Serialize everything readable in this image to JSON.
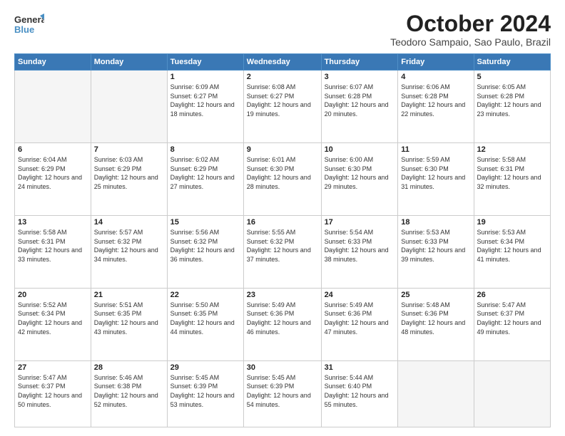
{
  "logo": {
    "line1": "General",
    "line2": "Blue"
  },
  "title": "October 2024",
  "subtitle": "Teodoro Sampaio, Sao Paulo, Brazil",
  "days_header": [
    "Sunday",
    "Monday",
    "Tuesday",
    "Wednesday",
    "Thursday",
    "Friday",
    "Saturday"
  ],
  "weeks": [
    [
      {
        "day": "",
        "detail": ""
      },
      {
        "day": "",
        "detail": ""
      },
      {
        "day": "1",
        "detail": "Sunrise: 6:09 AM\nSunset: 6:27 PM\nDaylight: 12 hours and 18 minutes."
      },
      {
        "day": "2",
        "detail": "Sunrise: 6:08 AM\nSunset: 6:27 PM\nDaylight: 12 hours and 19 minutes."
      },
      {
        "day": "3",
        "detail": "Sunrise: 6:07 AM\nSunset: 6:28 PM\nDaylight: 12 hours and 20 minutes."
      },
      {
        "day": "4",
        "detail": "Sunrise: 6:06 AM\nSunset: 6:28 PM\nDaylight: 12 hours and 22 minutes."
      },
      {
        "day": "5",
        "detail": "Sunrise: 6:05 AM\nSunset: 6:28 PM\nDaylight: 12 hours and 23 minutes."
      }
    ],
    [
      {
        "day": "6",
        "detail": "Sunrise: 6:04 AM\nSunset: 6:29 PM\nDaylight: 12 hours and 24 minutes."
      },
      {
        "day": "7",
        "detail": "Sunrise: 6:03 AM\nSunset: 6:29 PM\nDaylight: 12 hours and 25 minutes."
      },
      {
        "day": "8",
        "detail": "Sunrise: 6:02 AM\nSunset: 6:29 PM\nDaylight: 12 hours and 27 minutes."
      },
      {
        "day": "9",
        "detail": "Sunrise: 6:01 AM\nSunset: 6:30 PM\nDaylight: 12 hours and 28 minutes."
      },
      {
        "day": "10",
        "detail": "Sunrise: 6:00 AM\nSunset: 6:30 PM\nDaylight: 12 hours and 29 minutes."
      },
      {
        "day": "11",
        "detail": "Sunrise: 5:59 AM\nSunset: 6:30 PM\nDaylight: 12 hours and 31 minutes."
      },
      {
        "day": "12",
        "detail": "Sunrise: 5:58 AM\nSunset: 6:31 PM\nDaylight: 12 hours and 32 minutes."
      }
    ],
    [
      {
        "day": "13",
        "detail": "Sunrise: 5:58 AM\nSunset: 6:31 PM\nDaylight: 12 hours and 33 minutes."
      },
      {
        "day": "14",
        "detail": "Sunrise: 5:57 AM\nSunset: 6:32 PM\nDaylight: 12 hours and 34 minutes."
      },
      {
        "day": "15",
        "detail": "Sunrise: 5:56 AM\nSunset: 6:32 PM\nDaylight: 12 hours and 36 minutes."
      },
      {
        "day": "16",
        "detail": "Sunrise: 5:55 AM\nSunset: 6:32 PM\nDaylight: 12 hours and 37 minutes."
      },
      {
        "day": "17",
        "detail": "Sunrise: 5:54 AM\nSunset: 6:33 PM\nDaylight: 12 hours and 38 minutes."
      },
      {
        "day": "18",
        "detail": "Sunrise: 5:53 AM\nSunset: 6:33 PM\nDaylight: 12 hours and 39 minutes."
      },
      {
        "day": "19",
        "detail": "Sunrise: 5:53 AM\nSunset: 6:34 PM\nDaylight: 12 hours and 41 minutes."
      }
    ],
    [
      {
        "day": "20",
        "detail": "Sunrise: 5:52 AM\nSunset: 6:34 PM\nDaylight: 12 hours and 42 minutes."
      },
      {
        "day": "21",
        "detail": "Sunrise: 5:51 AM\nSunset: 6:35 PM\nDaylight: 12 hours and 43 minutes."
      },
      {
        "day": "22",
        "detail": "Sunrise: 5:50 AM\nSunset: 6:35 PM\nDaylight: 12 hours and 44 minutes."
      },
      {
        "day": "23",
        "detail": "Sunrise: 5:49 AM\nSunset: 6:36 PM\nDaylight: 12 hours and 46 minutes."
      },
      {
        "day": "24",
        "detail": "Sunrise: 5:49 AM\nSunset: 6:36 PM\nDaylight: 12 hours and 47 minutes."
      },
      {
        "day": "25",
        "detail": "Sunrise: 5:48 AM\nSunset: 6:36 PM\nDaylight: 12 hours and 48 minutes."
      },
      {
        "day": "26",
        "detail": "Sunrise: 5:47 AM\nSunset: 6:37 PM\nDaylight: 12 hours and 49 minutes."
      }
    ],
    [
      {
        "day": "27",
        "detail": "Sunrise: 5:47 AM\nSunset: 6:37 PM\nDaylight: 12 hours and 50 minutes."
      },
      {
        "day": "28",
        "detail": "Sunrise: 5:46 AM\nSunset: 6:38 PM\nDaylight: 12 hours and 52 minutes."
      },
      {
        "day": "29",
        "detail": "Sunrise: 5:45 AM\nSunset: 6:39 PM\nDaylight: 12 hours and 53 minutes."
      },
      {
        "day": "30",
        "detail": "Sunrise: 5:45 AM\nSunset: 6:39 PM\nDaylight: 12 hours and 54 minutes."
      },
      {
        "day": "31",
        "detail": "Sunrise: 5:44 AM\nSunset: 6:40 PM\nDaylight: 12 hours and 55 minutes."
      },
      {
        "day": "",
        "detail": ""
      },
      {
        "day": "",
        "detail": ""
      }
    ]
  ]
}
